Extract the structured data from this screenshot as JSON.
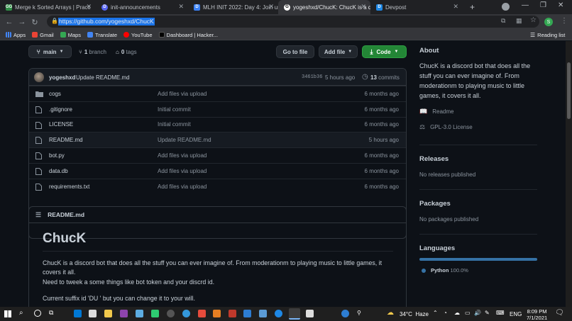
{
  "browser": {
    "tabs": [
      {
        "title": "Merge k Sorted Arrays | Practi",
        "favicon": "GG",
        "color": "#2f8d46"
      },
      {
        "title": "init-announcements",
        "favicon": "D",
        "color": "#5865f2"
      },
      {
        "title": "MLH INIT 2022: Day 4: Join us",
        "favicon": "D",
        "color": "#3b82f6"
      },
      {
        "title": "yogeshxd/ChucK: ChucK is a di",
        "favicon": "G",
        "color": "#ffffff"
      },
      {
        "title": "Devpost",
        "favicon": "D",
        "color": "#1e88e5"
      }
    ],
    "new_tab": "+",
    "url": "https://github.com/yogeshxd/ChucK",
    "profile_initial": "S",
    "bookmarks": [
      "Apps",
      "Gmail",
      "Maps",
      "Translate",
      "YouTube",
      "Dashboard | Hacker..."
    ],
    "reading_list": "Reading list"
  },
  "repo": {
    "branch": "main",
    "branch_count": "1",
    "branch_label": "branch",
    "tag_count": "0",
    "tag_label": "tags",
    "go_to_file": "Go to file",
    "add_file": "Add file",
    "code": "Code",
    "commit": {
      "author": "yogeshxd",
      "message": "Update README.md",
      "sha": "3461b36",
      "time": "5 hours ago",
      "count": "13",
      "count_label": "commits"
    },
    "files": [
      {
        "name": "cogs",
        "type": "folder",
        "message": "Add files via upload",
        "age": "6 months ago"
      },
      {
        "name": ".gitignore",
        "type": "file",
        "message": "Initial commit",
        "age": "6 months ago"
      },
      {
        "name": "LICENSE",
        "type": "file",
        "message": "Initial commit",
        "age": "6 months ago"
      },
      {
        "name": "README.md",
        "type": "file",
        "message": "Update README.md",
        "age": "5 hours ago"
      },
      {
        "name": "bot.py",
        "type": "file",
        "message": "Add files via upload",
        "age": "6 months ago"
      },
      {
        "name": "data.db",
        "type": "file",
        "message": "Add files via upload",
        "age": "6 months ago"
      },
      {
        "name": "requirements.txt",
        "type": "file",
        "message": "Add files via upload",
        "age": "6 months ago"
      }
    ],
    "readme": {
      "header": "README.md",
      "title": "ChucK",
      "p1": "ChucK is a discord bot that does all the stuff you can ever imagine of. From moderationm to playing music to little games, it covers it all.",
      "p2": "Need to tweek a some things like bot token and your discrd id.",
      "p3": "Current suffix id 'DU ' but you can change it to your will."
    }
  },
  "sidebar": {
    "about_title": "About",
    "description": "ChucK is a discord bot that does all the stuff you can ever imagine of. From moderationm to playing music to little games, it covers it all.",
    "readme": "Readme",
    "license": "GPL-3.0 License",
    "releases_title": "Releases",
    "releases_empty": "No releases published",
    "packages_title": "Packages",
    "packages_empty": "No packages published",
    "languages_title": "Languages",
    "language": {
      "name": "Python",
      "percent": "100.0%",
      "fraction": 1.0,
      "color": "#3572a5"
    }
  },
  "taskbar": {
    "temperature": "34°C",
    "weather": "Haze",
    "lang": "ENG",
    "time": "8:09 PM",
    "date": "7/1/2021"
  }
}
